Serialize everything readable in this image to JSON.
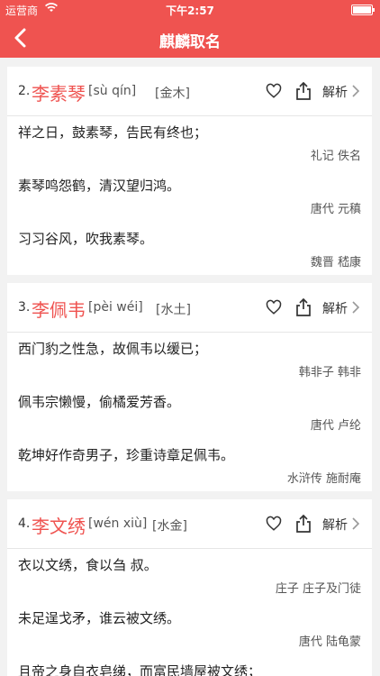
{
  "status": {
    "carrier": "运营商",
    "time": "下午2:57"
  },
  "nav": {
    "title": "麒麟取名"
  },
  "actions": {
    "analyze": "解析"
  },
  "cards": [
    {
      "index": "2.",
      "name": "李素琴",
      "pinyin": "[sù qín]",
      "wuxing": "[金木]",
      "quotes": [
        {
          "text": "祥之日，鼓素琴，告民有终也；",
          "source": "礼记 佚名"
        },
        {
          "text": "素琴鸣怨鹤，清汉望归鸿。",
          "source": "唐代 元稹"
        },
        {
          "text": "习习谷风，吹我素琴。",
          "source": "魏晋 嵇康"
        }
      ]
    },
    {
      "index": "3.",
      "name": "李佩韦",
      "pinyin": "[pèi wéi]",
      "wuxing": "[水土]",
      "quotes": [
        {
          "text": "西门豹之性急，故佩韦以缓已；",
          "source": "韩非子 韩非"
        },
        {
          "text": "佩韦宗懒慢，偷橘爱芳香。",
          "source": "唐代 卢纶"
        },
        {
          "text": "乾坤好作奇男子，珍重诗章足佩韦。",
          "source": "水浒传 施耐庵"
        }
      ]
    },
    {
      "index": "4.",
      "name": "李文绣",
      "pinyin": "[wén xiù]",
      "wuxing": "[水金]",
      "quotes": [
        {
          "text": "衣以文绣，食以刍 叔。",
          "source": "庄子 庄子及门徒"
        },
        {
          "text": "未足逞戈矛，谁云被文绣。",
          "source": "唐代 陆龟蒙"
        },
        {
          "text": "且帝之身自衣皂绨，而富民墙屋被文绣；",
          "source": ""
        }
      ]
    }
  ]
}
